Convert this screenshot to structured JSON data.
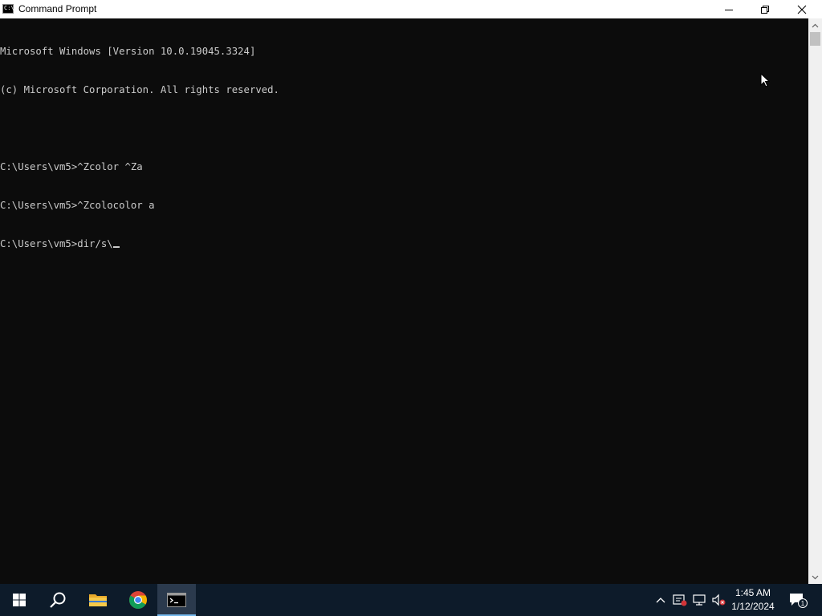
{
  "window": {
    "title": "Command Prompt"
  },
  "console": {
    "lines": [
      "Microsoft Windows [Version 10.0.19045.3324]",
      "(c) Microsoft Corporation. All rights reserved.",
      "",
      "C:\\Users\\vm5>^Zcolor ^Za",
      "C:\\Users\\vm5>^Zcolocolor a",
      "C:\\Users\\vm5>dir/s\\"
    ],
    "text_color": "#cccccc",
    "background": "#0c0c0c"
  },
  "taskbar": {
    "apps": [
      {
        "name": "start",
        "icon": "windows-logo-icon"
      },
      {
        "name": "search",
        "icon": "search-icon"
      },
      {
        "name": "file-explorer",
        "icon": "folder-icon"
      },
      {
        "name": "chrome",
        "icon": "chrome-icon"
      },
      {
        "name": "command-prompt",
        "icon": "cmd-icon",
        "active": true
      }
    ],
    "tray": {
      "icons": [
        "chevron-up-icon",
        "security-icon",
        "network-icon",
        "volume-muted-icon"
      ],
      "time": "1:45 AM",
      "date": "1/12/2024",
      "notification_count": "1"
    },
    "background": "#0d1b2a"
  }
}
